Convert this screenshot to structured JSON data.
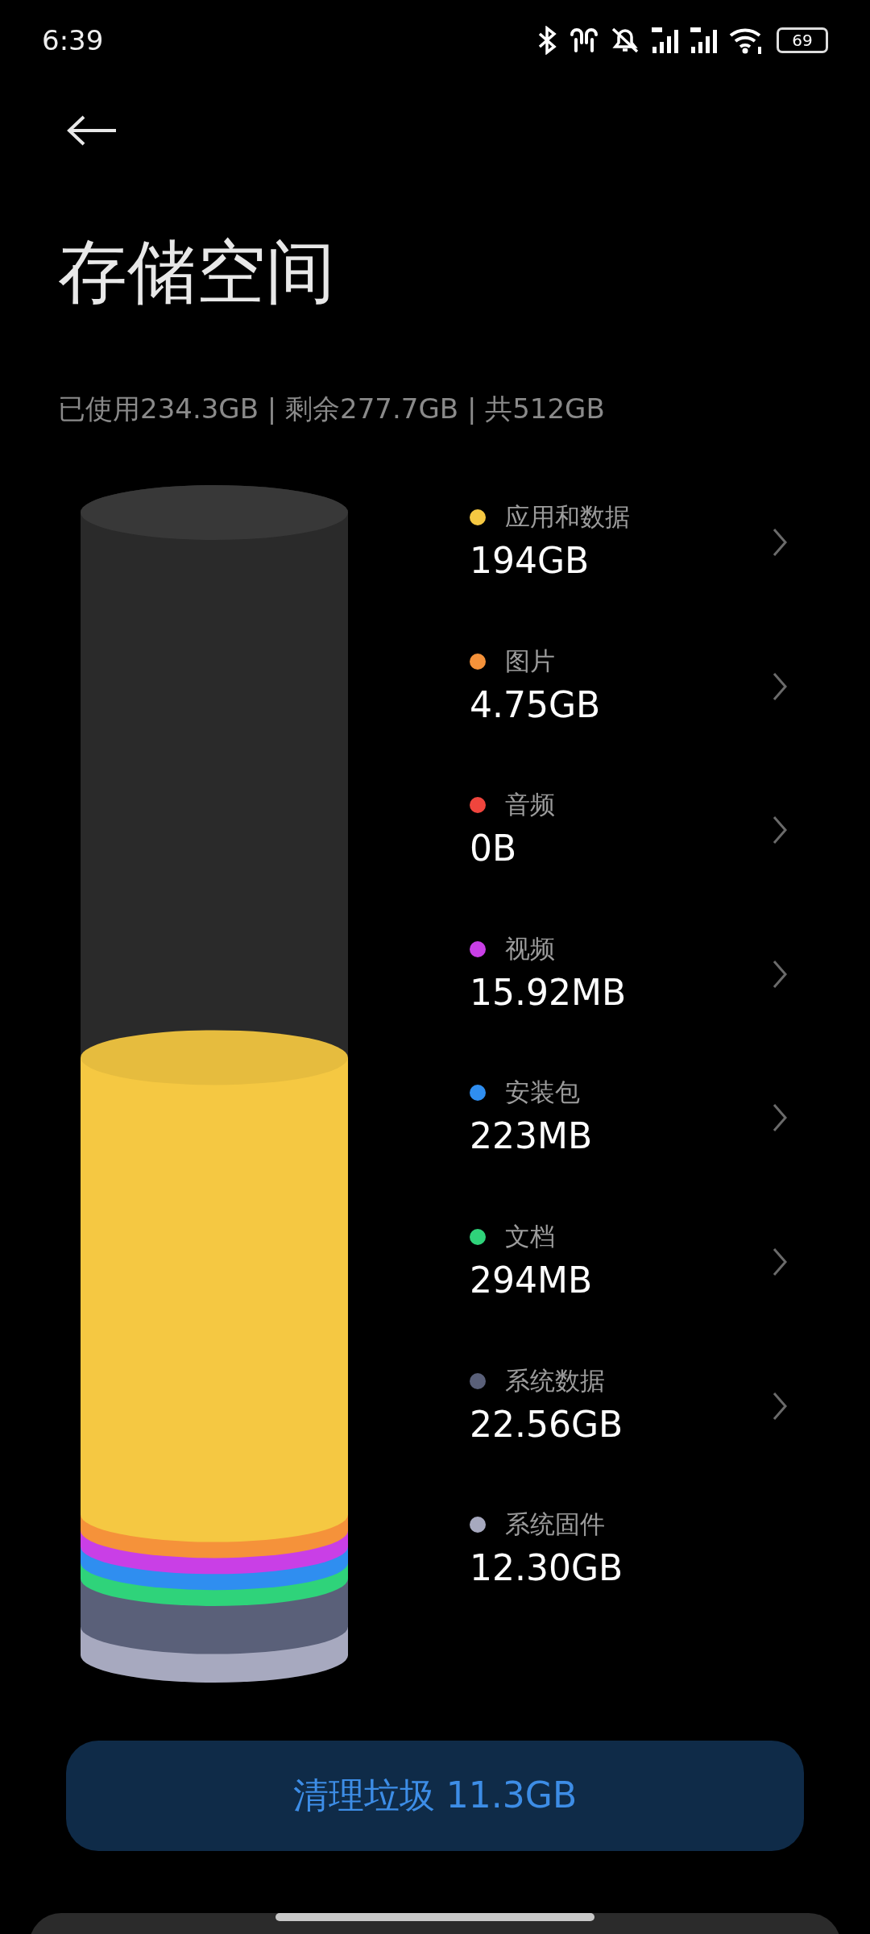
{
  "status_bar": {
    "time": "6:39",
    "battery": "69"
  },
  "title": "存储空间",
  "summary": "已使用234.3GB | 剩余277.7GB | 共512GB",
  "items": [
    {
      "label": "应用和数据",
      "value": "194GB",
      "color": "#f5c842",
      "chevron": true
    },
    {
      "label": "图片",
      "value": "4.75GB",
      "color": "#f5923a",
      "chevron": true
    },
    {
      "label": "音频",
      "value": "0B",
      "color": "#f0453d",
      "chevron": true
    },
    {
      "label": "视频",
      "value": "15.92MB",
      "color": "#c93fe6",
      "chevron": true
    },
    {
      "label": "安装包",
      "value": "223MB",
      "color": "#2f8ef0",
      "chevron": true
    },
    {
      "label": "文档",
      "value": "294MB",
      "color": "#2fd37a",
      "chevron": true
    },
    {
      "label": "系统数据",
      "value": "22.56GB",
      "color": "#5a6079",
      "chevron": true
    },
    {
      "label": "系统固件",
      "value": "12.30GB",
      "color": "#a7a9bf",
      "chevron": false
    }
  ],
  "clean_button": "清理垃圾 11.3GB"
}
